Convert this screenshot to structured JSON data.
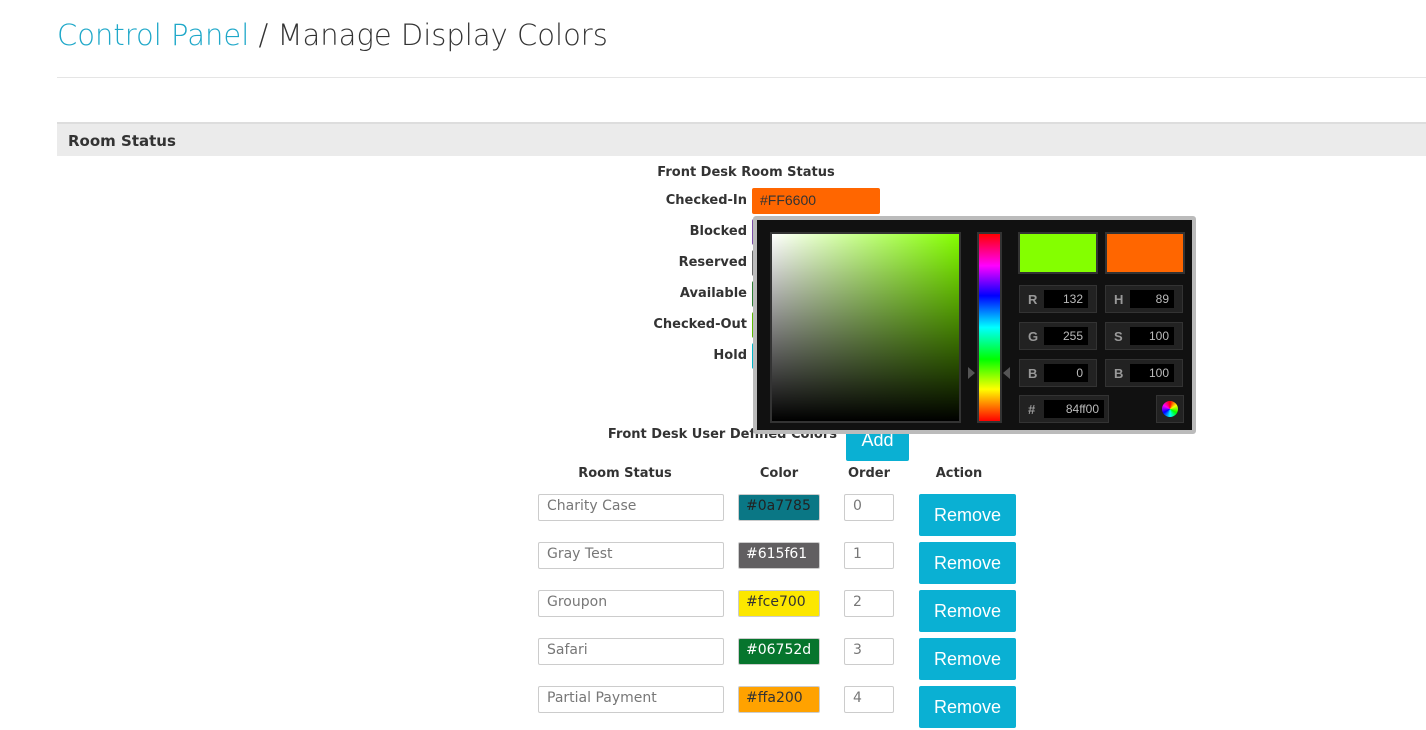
{
  "header": {
    "link": "Control Panel",
    "separator": " / ",
    "title": "Manage Display Colors"
  },
  "section": "Room Status",
  "front_desk": {
    "title": "Front Desk Room Status",
    "statuses": [
      {
        "label": "Checked-In",
        "value": "#FF6600",
        "color": "#ff6600"
      },
      {
        "label": "Blocked",
        "value": "",
        "color": "#7b4ea8"
      },
      {
        "label": "Reserved",
        "value": "",
        "color": "#666666"
      },
      {
        "label": "Available",
        "value": "",
        "color": "#2e7d32"
      },
      {
        "label": "Checked-Out",
        "value": "",
        "color": "#5cb800"
      },
      {
        "label": "Hold",
        "value": "",
        "color": "#00b4c8"
      }
    ]
  },
  "picker": {
    "new_color": "#84ff00",
    "old_color": "#ff6600",
    "fields": [
      {
        "k": "R",
        "v": "132"
      },
      {
        "k": "H",
        "v": "89"
      },
      {
        "k": "G",
        "v": "255"
      },
      {
        "k": "S",
        "v": "100"
      },
      {
        "k": "B",
        "v": "0"
      },
      {
        "k": "B",
        "v": "100"
      }
    ],
    "hex_label": "#",
    "hex": "84ff00"
  },
  "user_defined": {
    "title": "Front Desk User Defined Colors",
    "add_label": "Add",
    "columns": [
      "Room Status",
      "Color",
      "Order",
      "Action"
    ],
    "rows": [
      {
        "name": "Charity Case",
        "color": "#0a7785",
        "order": "0",
        "text": "#222"
      },
      {
        "name": "Gray Test",
        "color": "#615f61",
        "order": "1",
        "text": "#fff"
      },
      {
        "name": "Groupon",
        "color": "#fce700",
        "order": "2",
        "text": "#333"
      },
      {
        "name": "Safari",
        "color": "#06752d",
        "order": "3",
        "text": "#fff"
      },
      {
        "name": "Partial Payment",
        "color": "#ffa200",
        "order": "4",
        "text": "#333"
      }
    ],
    "remove_label": "Remove"
  }
}
